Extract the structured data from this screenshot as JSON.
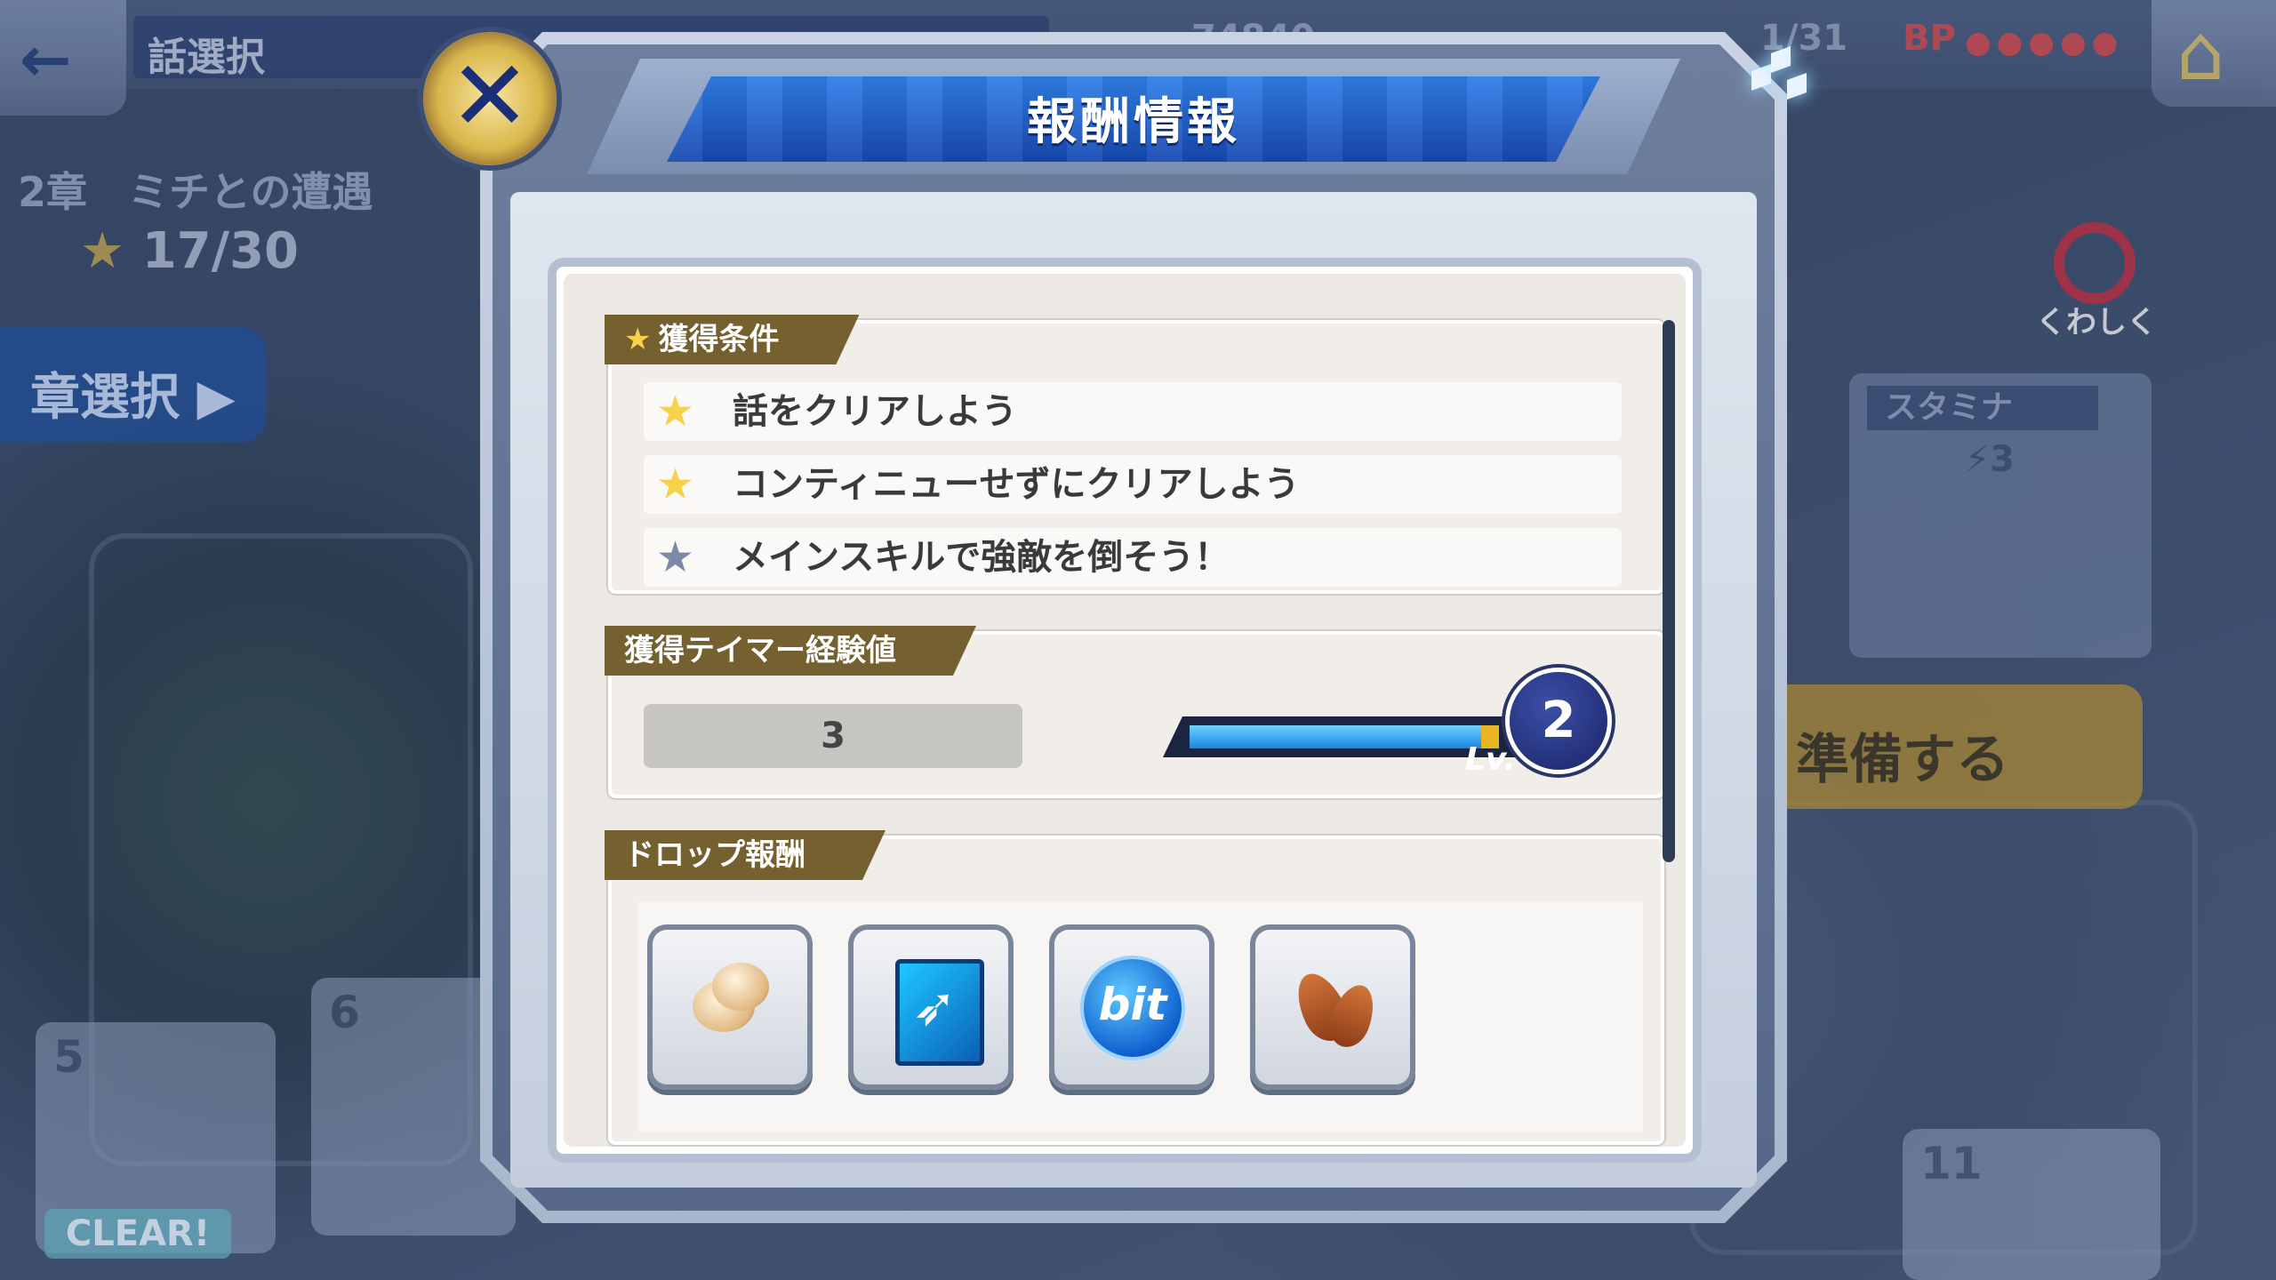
{
  "background": {
    "back_icon": "←",
    "title": "話選択",
    "top_stat_1": "74840",
    "top_stat_2": "1/31",
    "bp_label": "BP",
    "bp_dots": "●●●●●",
    "home_icon": "⌂",
    "chapter_title": "2章　ミチとの遭遇",
    "star_count": "17/30",
    "chapter_select_label": "章選択 ▶",
    "detail_label": "くわしく",
    "stamina_label": "スタミナ",
    "stamina_value": "⚡3",
    "prepare_label": "準備する",
    "stage_numbers": [
      "5",
      "6",
      "11"
    ],
    "clear_badge": "CLEAR!"
  },
  "modal": {
    "title": "報酬情報",
    "close_icon": "✕",
    "conditions": {
      "header": "獲得条件",
      "items": [
        {
          "text": "話をクリアしよう",
          "achieved": true
        },
        {
          "text": "コンティニューせずにクリアしよう",
          "achieved": true
        },
        {
          "text": "メインスキルで強敵を倒そう！",
          "achieved": false
        }
      ]
    },
    "experience": {
      "header": "獲得テイマー経験値",
      "value": "3",
      "level_label": "Lv.",
      "level": "2",
      "gauge_fill": 0.82,
      "gauge_gain": 0.05
    },
    "drops": {
      "header": "ドロップ報酬",
      "items": [
        {
          "icon": "eggs-icon"
        },
        {
          "icon": "crossbow-card-icon"
        },
        {
          "icon": "bit-coin-icon",
          "label": "bit"
        },
        {
          "icon": "almonds-icon"
        }
      ]
    }
  },
  "colors": {
    "section_header": "#75602f",
    "star_gold": "#f6d24a",
    "star_gray": "#7c89a8",
    "title_blue": "#1749b0",
    "gauge_blue": "#1b85e0",
    "gauge_gain": "#e8b423"
  }
}
